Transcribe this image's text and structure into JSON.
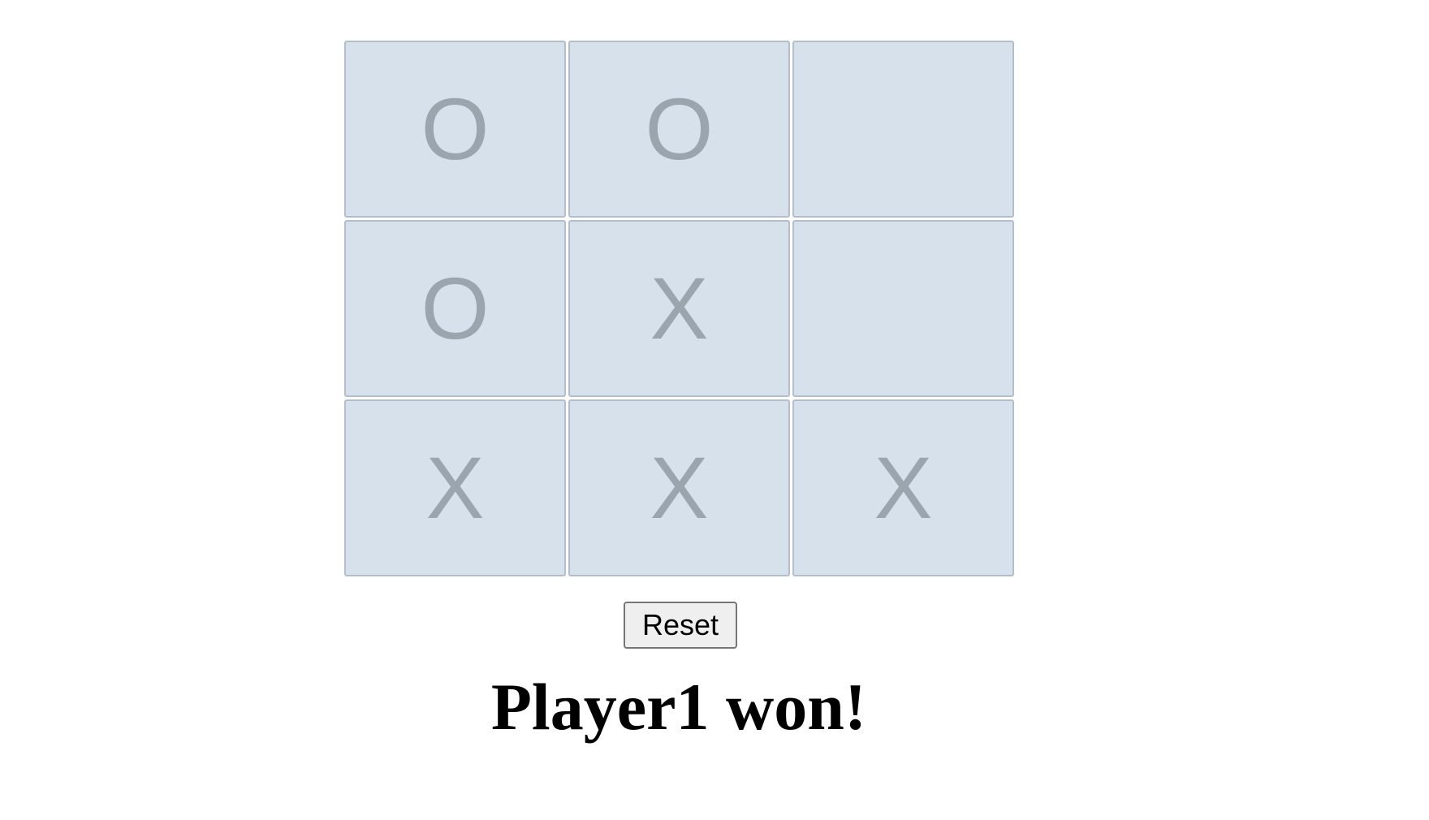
{
  "board": {
    "cells": [
      "O",
      "O",
      "",
      "O",
      "X",
      "",
      "X",
      "X",
      "X"
    ]
  },
  "controls": {
    "reset_label": "Reset"
  },
  "status": {
    "message": "Player1 won!"
  },
  "colors": {
    "cell_background": "#d6e1ec",
    "cell_border": "#b2bfcb",
    "mark_color": "#9aa5ae"
  }
}
